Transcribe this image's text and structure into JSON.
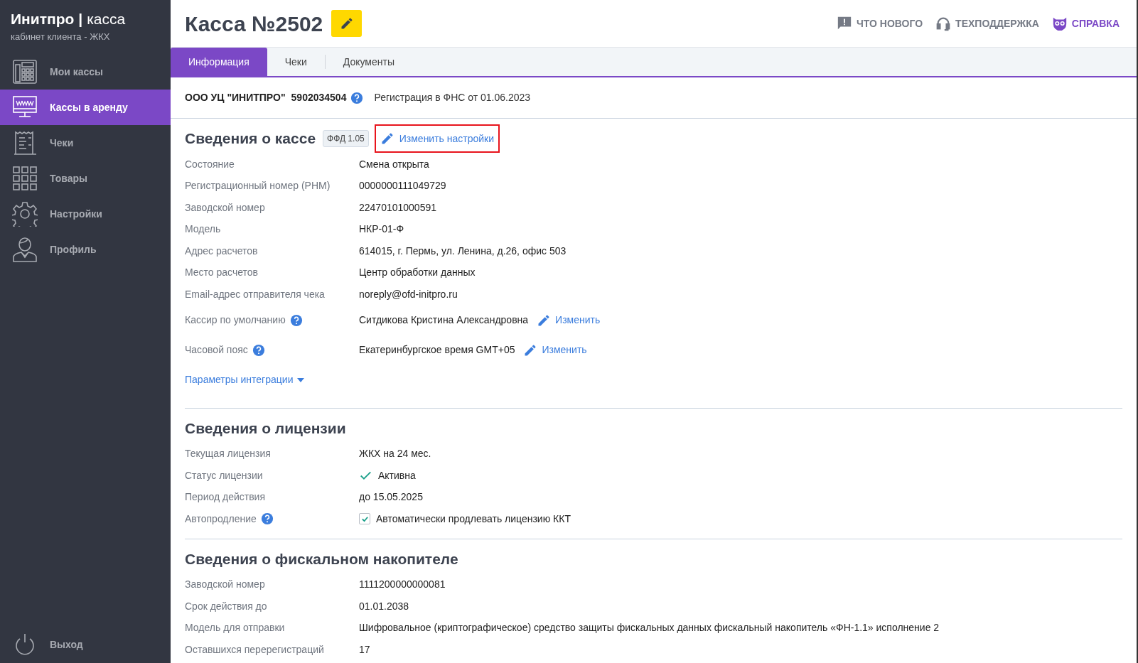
{
  "sidebar": {
    "brand": "Инитпро",
    "separator": "|",
    "product": "касса",
    "subtitle": "кабинет клиента - ЖКХ",
    "items": [
      {
        "label": "Мои кассы",
        "selected": false
      },
      {
        "label": "Кассы в аренду",
        "selected": true
      },
      {
        "label": "Чеки",
        "selected": false
      },
      {
        "label": "Товары",
        "selected": false
      },
      {
        "label": "Настройки",
        "selected": false
      },
      {
        "label": "Профиль",
        "selected": false
      }
    ],
    "logout": {
      "label": "Выход"
    }
  },
  "header": {
    "title": "Касса №2502",
    "links": [
      {
        "label": "ЧТО НОВОГО",
        "kind": "news"
      },
      {
        "label": "ТЕХПОДДЕРЖКА",
        "kind": "support"
      },
      {
        "label": "СПРАВКА",
        "kind": "help"
      }
    ]
  },
  "tabs": [
    {
      "label": "Информация",
      "selected": true
    },
    {
      "label": "Чеки",
      "selected": false
    },
    {
      "label": "Документы",
      "selected": false
    }
  ],
  "organization": {
    "name": "ООО УЦ \"ИНИТПРО\"",
    "inn": "5902034504",
    "registration": "Регистрация в ФНС от 01.06.2023"
  },
  "sections": [
    {
      "title": "Сведения о кассе",
      "badge": "ФФД 1.05",
      "action": {
        "label": "Изменить настройки",
        "highlighted": true
      },
      "rows": [
        {
          "kind": "text",
          "label": "Состояние",
          "value": "Смена открыта",
          "help": false
        },
        {
          "kind": "text",
          "label": "Регистрационный номер (РНМ)",
          "value": "0000000111049729",
          "help": false
        },
        {
          "kind": "text",
          "label": "Заводской номер",
          "value": "22470101000591",
          "help": false
        },
        {
          "kind": "text",
          "label": "Модель",
          "value": "НКР-01-Ф",
          "help": false
        },
        {
          "kind": "text",
          "label": "Адрес расчетов",
          "value": "614015, г. Пермь, ул. Ленина, д.26, офис 503",
          "help": false
        },
        {
          "kind": "text",
          "label": "Место расчетов",
          "value": "Центр обработки данных",
          "help": false
        },
        {
          "kind": "text",
          "label": "Email-адрес отправителя чека",
          "value": "noreply@ofd-initpro.ru",
          "help": false
        },
        {
          "kind": "edit",
          "label": "Кассир по умолчанию",
          "value": "Ситдикова Кристина Александровна",
          "help": true,
          "action": "Изменить"
        },
        {
          "kind": "edit",
          "label": "Часовой пояс",
          "value": "Екатеринбургское время GMT+05",
          "help": true,
          "action": "Изменить"
        }
      ],
      "expander": {
        "label": "Параметры интеграции",
        "expanded": false
      }
    },
    {
      "title": "Сведения о лицензии",
      "rows": [
        {
          "kind": "text",
          "label": "Текущая лицензия",
          "value": "ЖКХ на 24 мес.",
          "help": false
        },
        {
          "kind": "status",
          "label": "Статус лицензии",
          "value": "Активна",
          "help": false
        },
        {
          "kind": "text",
          "label": "Период действия",
          "value": "до 15.05.2025",
          "help": false
        },
        {
          "kind": "checkbox",
          "label": "Автопродление",
          "value": "Автоматически продлевать лицензию ККТ",
          "help": true,
          "checked": true
        }
      ]
    },
    {
      "title": "Сведения о фискальном накопителе",
      "rows": [
        {
          "kind": "text",
          "label": "Заводской номер",
          "value": "1111200000000081",
          "help": false
        },
        {
          "kind": "text",
          "label": "Срок действия до",
          "value": "01.01.2038",
          "help": false
        },
        {
          "kind": "text",
          "label": "Модель для отправки",
          "value": "Шифровальное (криптографическое) средство защиты фискальных данных фискальный накопитель «ФН-1.1» исполнение 2",
          "help": false
        },
        {
          "kind": "text",
          "label": "Оставшихся перерегистраций",
          "value": "17",
          "help": false
        }
      ]
    }
  ]
}
